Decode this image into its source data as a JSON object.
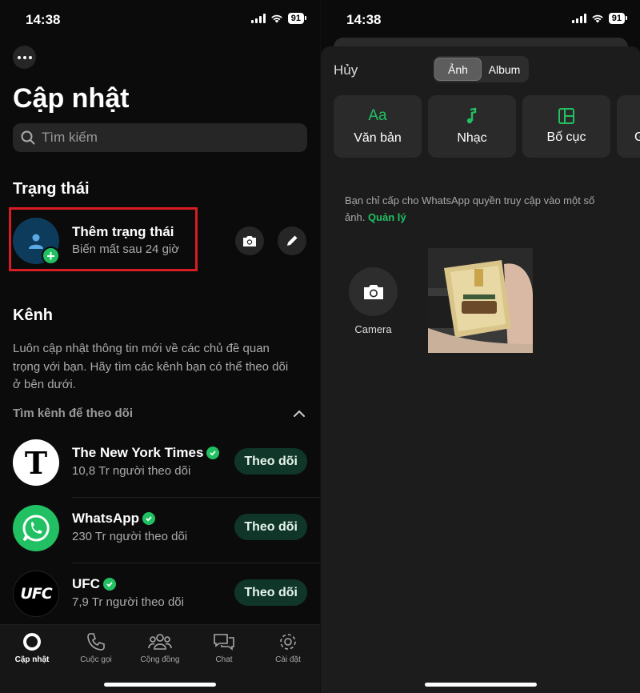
{
  "status_bar": {
    "time": "14:38",
    "battery": "91"
  },
  "left": {
    "title": "Cập nhật",
    "search_placeholder": "Tìm kiếm",
    "status_section": "Trạng thái",
    "my_status": {
      "title": "Thêm trạng thái",
      "subtitle": "Biến mất sau 24 giờ"
    },
    "channels_section": "Kênh",
    "channels_desc": "Luôn cập nhật thông tin mới về các chủ đề quan trọng với bạn. Hãy tìm các kênh bạn có thể theo dõi ở bên dưới.",
    "find_label": "Tìm kênh để theo dõi",
    "channels": [
      {
        "name": "The New York Times",
        "followers": "10,8 Tr người theo dõi",
        "button": "Theo dõi"
      },
      {
        "name": "WhatsApp",
        "followers": "230 Tr người theo dõi",
        "button": "Theo dõi"
      },
      {
        "name": "UFC",
        "followers": "7,9 Tr người theo dõi",
        "button": "Theo dõi"
      }
    ],
    "tabs": [
      "Cập nhật",
      "Cuộc gọi",
      "Cộng đồng",
      "Chat",
      "Cài đặt"
    ]
  },
  "right": {
    "cancel": "Hủy",
    "segments": [
      "Ảnh",
      "Album"
    ],
    "tiles": [
      {
        "icon": "text-aa-icon",
        "label": "Văn bản",
        "glyph": "Aa"
      },
      {
        "icon": "music-note-icon",
        "label": "Nhạc"
      },
      {
        "icon": "layout-icon",
        "label": "Bố cục"
      },
      {
        "icon": "gif-icon",
        "label": "G"
      }
    ],
    "permission_text": "Bạn chỉ cấp cho WhatsApp quyền truy cập vào một số ảnh.",
    "permission_link": "Quản lý",
    "camera_label": "Camera"
  },
  "colors": {
    "accent": "#21c063",
    "highlight_border": "#d81c23",
    "follow_bg": "#103529"
  }
}
